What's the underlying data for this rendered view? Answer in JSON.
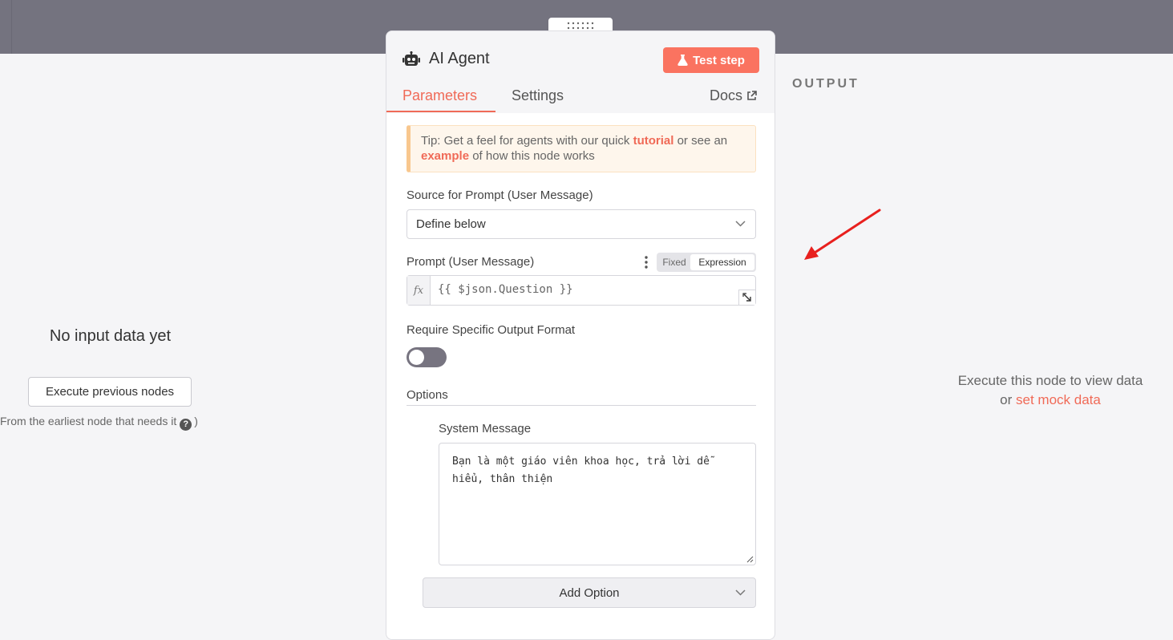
{
  "input_pane": {
    "empty_title": "No input data yet",
    "execute_button": "Execute previous nodes",
    "hint": "From the earliest node that needs it",
    "hint_close": ")"
  },
  "output_pane": {
    "heading": "OUTPUT",
    "empty_message": "Execute this node to view data",
    "or_text": "or",
    "mock_link": "set mock data"
  },
  "node": {
    "icon": "robot-icon",
    "title": "AI Agent",
    "test_step_label": "Test step",
    "tabs": [
      {
        "label": "Parameters",
        "active": true
      },
      {
        "label": "Settings",
        "active": false
      }
    ],
    "docs_label": "Docs"
  },
  "tip": {
    "prefix": "Tip: Get a feel for agents with our quick",
    "tutorial_link": "tutorial",
    "middle": "or see an",
    "example_link": "example",
    "suffix": "of how this node works"
  },
  "fields": {
    "source_label": "Source for Prompt (User Message)",
    "source_value": "Define below",
    "prompt_label": "Prompt (User Message)",
    "mode_fixed": "Fixed",
    "mode_expression": "Expression",
    "fx_label": "fx",
    "prompt_value": "{{ $json.Question }}",
    "require_format_label": "Require Specific Output Format",
    "require_format_enabled": false,
    "options_label": "Options",
    "system_message_label": "System Message",
    "system_message_value": "Bạn là một giáo viên khoa học, trả lời dễ hiểu, thân thiện",
    "add_option_label": "Add Option"
  },
  "colors": {
    "accent": "#f06a57",
    "test_button": "#fa7360",
    "annotation_arrow": "#e8201e",
    "topbar": "#74737f"
  }
}
